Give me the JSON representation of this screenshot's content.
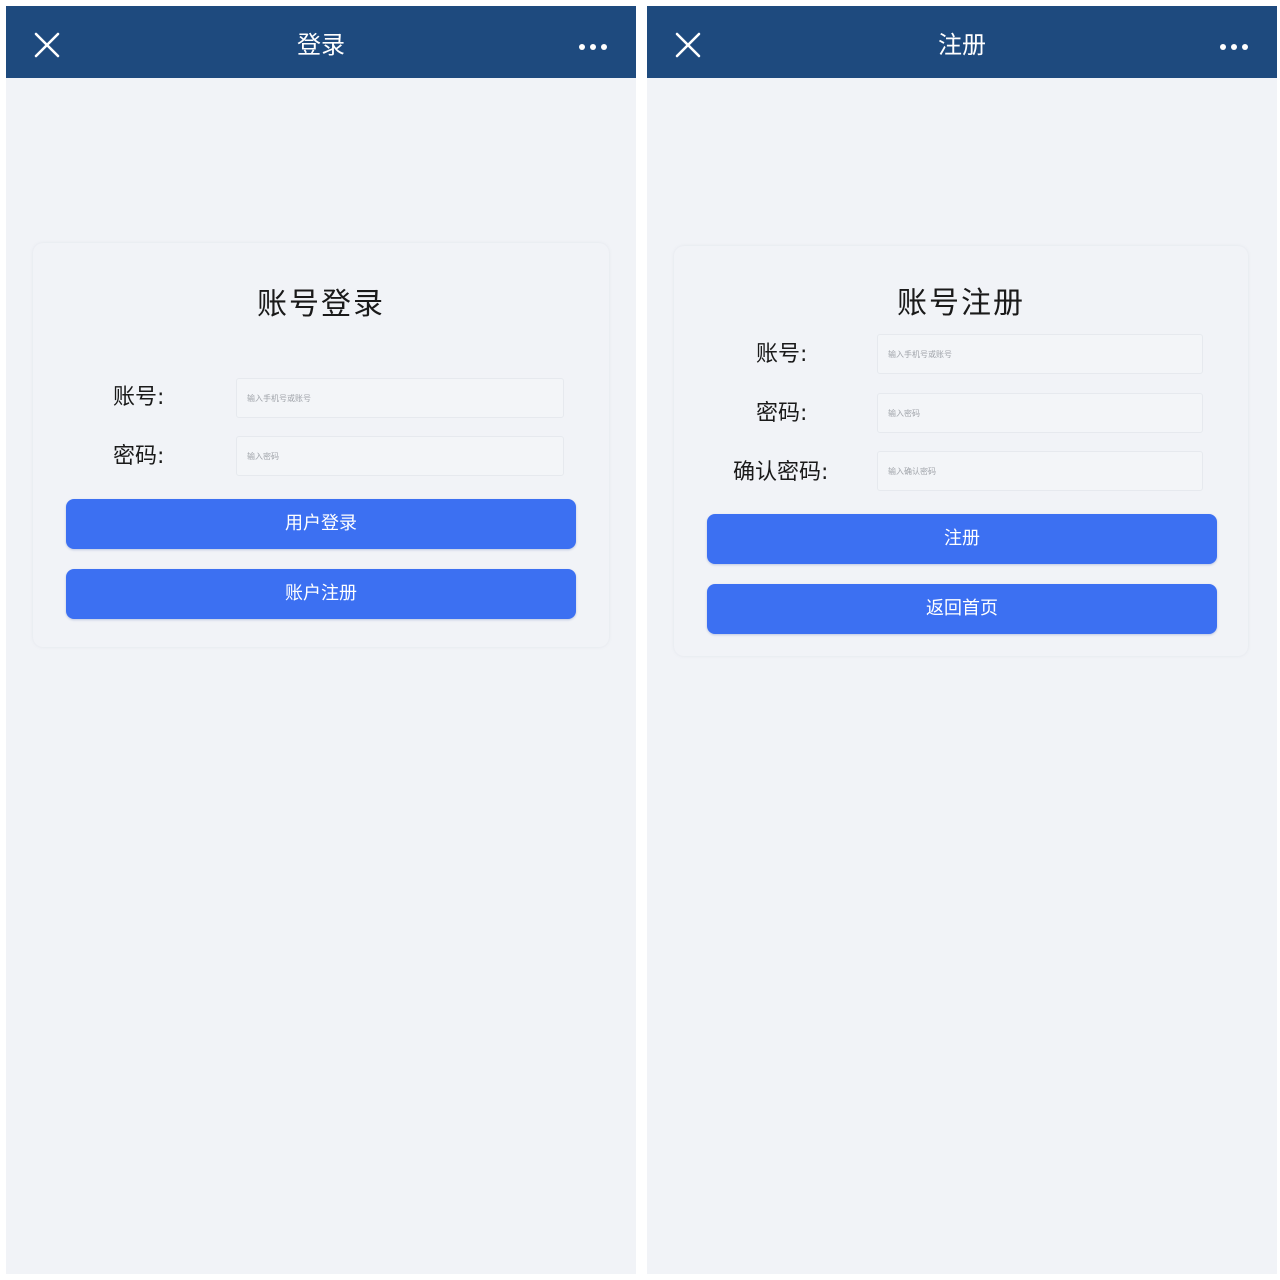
{
  "login_screen": {
    "header": {
      "close_icon": "close-icon",
      "title": "登录",
      "more_icon": "more-icon"
    },
    "card": {
      "title": "账号登录",
      "fields": {
        "account": {
          "label": "账号:",
          "placeholder": "输入手机号或账号",
          "value": ""
        },
        "password": {
          "label": "密码:",
          "placeholder": "输入密码",
          "value": ""
        }
      },
      "buttons": {
        "login": "用户登录",
        "register": "账户注册"
      }
    }
  },
  "register_screen": {
    "header": {
      "close_icon": "close-icon",
      "title": "注册",
      "more_icon": "more-icon"
    },
    "card": {
      "title": "账号注册",
      "fields": {
        "account": {
          "label": "账号:",
          "placeholder": "输入手机号或账号",
          "value": ""
        },
        "password": {
          "label": "密码:",
          "placeholder": "输入密码",
          "value": ""
        },
        "confirm_password": {
          "label": "确认密码:",
          "placeholder": "输入确认密码",
          "value": ""
        }
      },
      "buttons": {
        "register": "注册",
        "back_home": "返回首页"
      }
    }
  },
  "colors": {
    "navbar": "#1e4a7e",
    "page_background": "#f1f3f7",
    "button": "#3c70f2",
    "button_text": "#ffffff"
  }
}
